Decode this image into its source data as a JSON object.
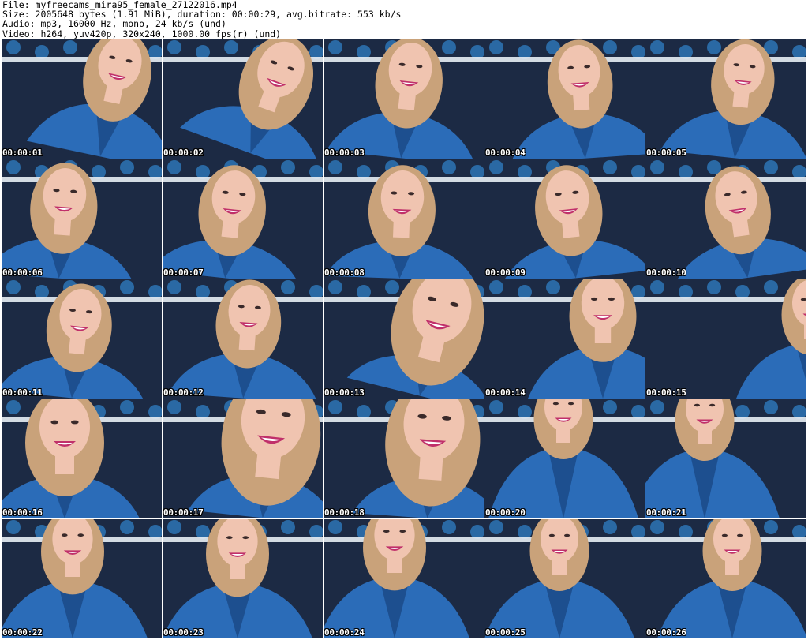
{
  "header": {
    "file_line": "File: myfreecams_mira95_female_27122016.mp4",
    "size_line": "Size: 2005648 bytes (1.91 MiB), duration: 00:00:29, avg.bitrate: 553 kb/s",
    "audio_line": "Audio: mp3, 16000 Hz, mono, 24 kb/s (und)",
    "video_line": "Video: h264, yuv420p, 320x240, 1000.00 fps(r) (und)"
  },
  "colors": {
    "wallpaper": "#1c2a44",
    "wallpaper_pattern": "#2f7fc4",
    "stripe": "#e8eef5",
    "shirt": "#2b6cb8",
    "shirt_dark": "#1d4f8f",
    "hair": "#c9a27a",
    "skin": "#f0c4b0",
    "lips": "#c0306a"
  },
  "frames": [
    {
      "timestamp": "00:00:01",
      "icon": "frame-thumbnail"
    },
    {
      "timestamp": "00:00:02",
      "icon": "frame-thumbnail"
    },
    {
      "timestamp": "00:00:03",
      "icon": "frame-thumbnail"
    },
    {
      "timestamp": "00:00:04",
      "icon": "frame-thumbnail"
    },
    {
      "timestamp": "00:00:05",
      "icon": "frame-thumbnail"
    },
    {
      "timestamp": "00:00:06",
      "icon": "frame-thumbnail"
    },
    {
      "timestamp": "00:00:07",
      "icon": "frame-thumbnail"
    },
    {
      "timestamp": "00:00:08",
      "icon": "frame-thumbnail"
    },
    {
      "timestamp": "00:00:09",
      "icon": "frame-thumbnail"
    },
    {
      "timestamp": "00:00:10",
      "icon": "frame-thumbnail"
    },
    {
      "timestamp": "00:00:11",
      "icon": "frame-thumbnail"
    },
    {
      "timestamp": "00:00:12",
      "icon": "frame-thumbnail"
    },
    {
      "timestamp": "00:00:13",
      "icon": "frame-thumbnail"
    },
    {
      "timestamp": "00:00:14",
      "icon": "frame-thumbnail"
    },
    {
      "timestamp": "00:00:15",
      "icon": "frame-thumbnail"
    },
    {
      "timestamp": "00:00:16",
      "icon": "frame-thumbnail"
    },
    {
      "timestamp": "00:00:17",
      "icon": "frame-thumbnail"
    },
    {
      "timestamp": "00:00:18",
      "icon": "frame-thumbnail"
    },
    {
      "timestamp": "00:00:20",
      "icon": "frame-thumbnail"
    },
    {
      "timestamp": "00:00:21",
      "icon": "frame-thumbnail"
    },
    {
      "timestamp": "00:00:22",
      "icon": "frame-thumbnail"
    },
    {
      "timestamp": "00:00:23",
      "icon": "frame-thumbnail"
    },
    {
      "timestamp": "00:00:24",
      "icon": "frame-thumbnail"
    },
    {
      "timestamp": "00:00:25",
      "icon": "frame-thumbnail"
    },
    {
      "timestamp": "00:00:26",
      "icon": "frame-thumbnail"
    }
  ]
}
